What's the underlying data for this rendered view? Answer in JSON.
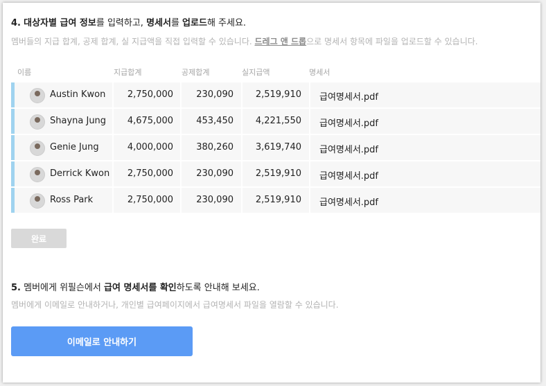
{
  "step4": {
    "title_num": "4.",
    "title_t1": "대상자별 급여 정보",
    "title_t2": "를 입력하고, ",
    "title_t3": "명세서",
    "title_t4": "를 ",
    "title_t5": "업로드",
    "title_t6": "해 주세요.",
    "desc_part1": "멤버들의 지급 합계, 공제 합계, 실 지급액을 직접 입력할 수 있습니다. ",
    "desc_link": "드레그 앤 드롭",
    "desc_part2": "으로 명세서 항목에 파일을 업로드할 수 있습니다."
  },
  "table": {
    "headers": [
      "이름",
      "지급합계",
      "공제합계",
      "실지급액",
      "명세서"
    ],
    "rows": [
      {
        "name": "Austin Kwon",
        "pay": "2,750,000",
        "deduction": "230,090",
        "net": "2,519,910",
        "file": "급여명세서.pdf"
      },
      {
        "name": "Shayna Jung",
        "pay": "4,675,000",
        "deduction": "453,450",
        "net": "4,221,550",
        "file": "급여명세서.pdf"
      },
      {
        "name": "Genie Jung",
        "pay": "4,000,000",
        "deduction": "380,260",
        "net": "3,619,740",
        "file": "급여명세서.pdf"
      },
      {
        "name": "Derrick Kwon",
        "pay": "2,750,000",
        "deduction": "230,090",
        "net": "2,519,910",
        "file": "급여명세서.pdf"
      },
      {
        "name": "Ross Park",
        "pay": "2,750,000",
        "deduction": "230,090",
        "net": "2,519,910",
        "file": "급여명세서.pdf"
      }
    ]
  },
  "done_button": "완료",
  "step5": {
    "title_num": "5.",
    "title_t1": " 멤버에게 위필슨에서 ",
    "title_t2": "급여 명세서를 확인",
    "title_t3": "하도록 안내해 보세요.",
    "desc": "멤버에게 이메일로 안내하거나, 개인별 급여페이지에서 급여명세서 파일을 열람할 수 있습니다."
  },
  "email_button": "이메일로 안내하기",
  "colors": {
    "row_accent": "#9fd3ef",
    "primary": "#5b9bf5",
    "disabled": "#d9d9d9"
  }
}
